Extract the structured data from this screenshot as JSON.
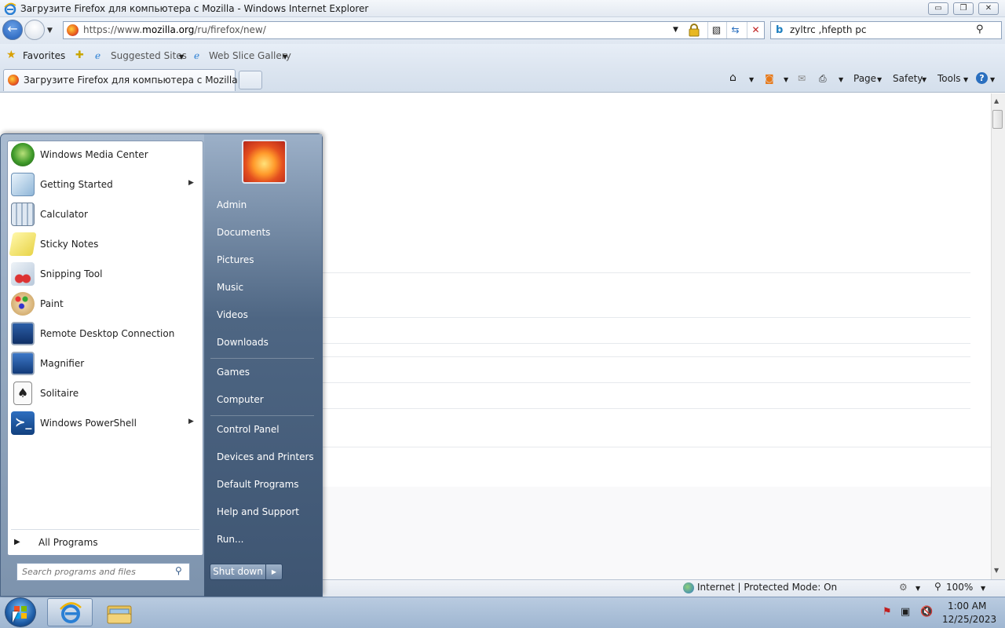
{
  "window": {
    "title": "Загрузите Firefox для компьютера с Mozilla - Windows Internet Explorer",
    "minimize": "▭",
    "restore": "❐",
    "close": "✕"
  },
  "address": {
    "url_prefix": "https://www.",
    "url_domain": "mozilla.org",
    "url_path": "/ru/firefox/new/"
  },
  "search": {
    "query": "zyltrc ,hfepth pc"
  },
  "favorites_bar": {
    "favorites_label": "Favorites",
    "suggested_sites": "Suggested Sites",
    "web_slice_gallery": "Web Slice Gallery"
  },
  "tabs": [
    {
      "label": "Загрузите Firefox для компьютера с Mozilla"
    }
  ],
  "command_bar": {
    "page": "Page",
    "safety": "Safety",
    "tools": "Tools"
  },
  "status": {
    "zone": "Internet | Protected Mode: On",
    "zoom": "100%"
  },
  "start_menu": {
    "programs": [
      {
        "label": "Windows Media Center",
        "icon": "media-center-icon",
        "submenu": false
      },
      {
        "label": "Getting Started",
        "icon": "getting-started-icon",
        "submenu": true
      },
      {
        "label": "Calculator",
        "icon": "calculator-icon",
        "submenu": false
      },
      {
        "label": "Sticky Notes",
        "icon": "sticky-notes-icon",
        "submenu": false
      },
      {
        "label": "Snipping Tool",
        "icon": "snipping-tool-icon",
        "submenu": false
      },
      {
        "label": "Paint",
        "icon": "paint-icon",
        "submenu": false
      },
      {
        "label": "Remote Desktop Connection",
        "icon": "remote-desktop-icon",
        "submenu": false
      },
      {
        "label": "Magnifier",
        "icon": "magnifier-icon",
        "submenu": false
      },
      {
        "label": "Solitaire",
        "icon": "solitaire-icon",
        "submenu": false
      },
      {
        "label": "Windows PowerShell",
        "icon": "powershell-icon",
        "submenu": true
      }
    ],
    "all_programs": "All Programs",
    "search_placeholder": "Search programs and files",
    "right_links": {
      "admin": "Admin",
      "documents": "Documents",
      "pictures": "Pictures",
      "music": "Music",
      "videos": "Videos",
      "downloads": "Downloads",
      "games": "Games",
      "computer": "Computer",
      "control_panel": "Control Panel",
      "devices_printers": "Devices and Printers",
      "default_programs": "Default Programs",
      "help_support": "Help and Support",
      "run": "Run..."
    },
    "shutdown": "Shut down"
  },
  "taskbar": {
    "time": "1:00 AM",
    "date": "12/25/2023"
  }
}
